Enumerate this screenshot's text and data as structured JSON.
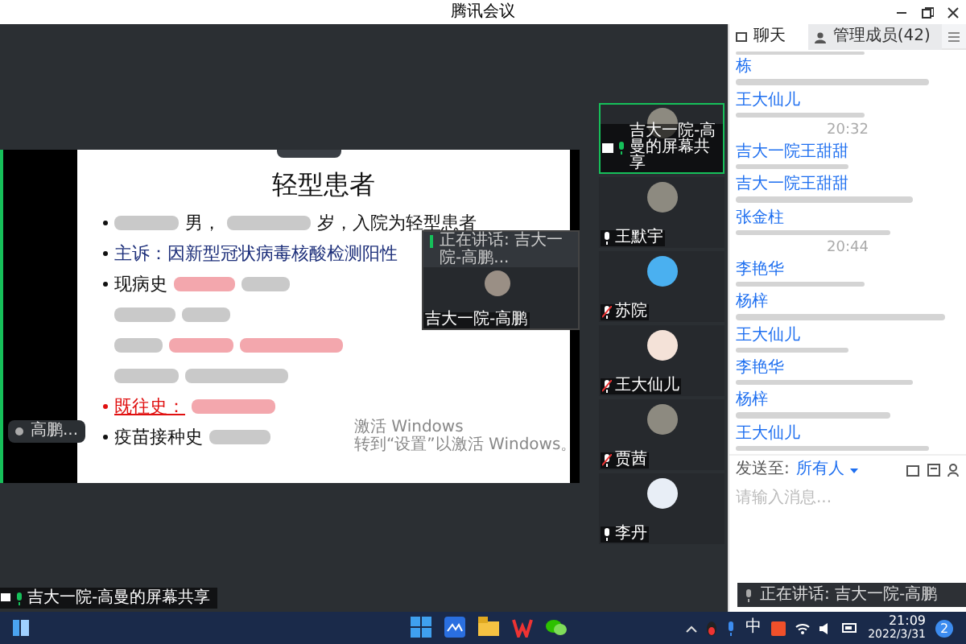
{
  "window": {
    "title": "腾讯会议"
  },
  "slide": {
    "title": "轻型患者",
    "bullets": [
      {
        "marker": true,
        "emphasis": false,
        "parts": [
          {
            "kind": "blur"
          },
          {
            "kind": "text",
            "text": "男，"
          },
          {
            "kind": "blur"
          },
          {
            "kind": "text",
            "text": "岁，入院为轻型患者"
          }
        ]
      },
      {
        "marker": true,
        "emphasis": false,
        "parts": [
          {
            "kind": "text",
            "text": "主诉：因新型冠状病毒核酸检测阳性"
          }
        ]
      },
      {
        "marker": true,
        "emphasis": false,
        "parts": [
          {
            "kind": "text",
            "text": "现病史"
          },
          {
            "kind": "redblur"
          },
          {
            "kind": "blur"
          }
        ]
      },
      {
        "marker": false,
        "parts": [
          {
            "kind": "blur"
          },
          {
            "kind": "blur"
          }
        ]
      },
      {
        "marker": false,
        "parts": [
          {
            "kind": "blur"
          },
          {
            "kind": "redblur"
          },
          {
            "kind": "redblur"
          }
        ]
      },
      {
        "marker": false,
        "parts": [
          {
            "kind": "blur"
          },
          {
            "kind": "blur"
          }
        ]
      },
      {
        "marker": true,
        "emphasis": true,
        "parts": [
          {
            "kind": "text",
            "text": "既往史："
          },
          {
            "kind": "redblur"
          }
        ]
      },
      {
        "marker": true,
        "emphasis": false,
        "parts": [
          {
            "kind": "text",
            "text": "疫苗接种史"
          },
          {
            "kind": "blur"
          }
        ]
      }
    ]
  },
  "activation_notice": [
    "激活 Windows",
    "转到“设置”以激活 Windows。"
  ],
  "side_label": "高鹏...",
  "presenter_label": "吉大一院-高曼的屏幕共享",
  "floating_video": {
    "speaking": "正在讲话: 吉大一院-高鹏...",
    "name": "吉大一院-高鹏"
  },
  "participants": [
    {
      "kind": "photo",
      "name": "吉大一院-高曼的屏幕共享",
      "speaking": true,
      "muted": false,
      "sharing": true
    },
    {
      "kind": "photo",
      "name": "王默宇",
      "speaking": false,
      "muted": false,
      "sharing": false
    },
    {
      "kind": "sky",
      "name": "苏院",
      "speaking": false,
      "muted": true,
      "sharing": false
    },
    {
      "kind": "cat",
      "name": "王大仙儿",
      "speaking": false,
      "muted": true,
      "sharing": false
    },
    {
      "kind": "photo",
      "name": "贾茜",
      "speaking": false,
      "muted": true,
      "sharing": false
    },
    {
      "kind": "doctor",
      "name": "李丹",
      "speaking": false,
      "muted": false,
      "sharing": false
    }
  ],
  "chat": {
    "tabs": [
      {
        "label": "聊天",
        "selected": true
      },
      {
        "label": "管理成员(42)",
        "selected": false
      }
    ],
    "items": [
      {
        "kind": "blur"
      },
      {
        "kind": "message",
        "sender": "栋"
      },
      {
        "kind": "message",
        "sender": "王大仙儿"
      },
      {
        "kind": "time",
        "text": "20:32"
      },
      {
        "kind": "message",
        "sender": "吉大一院王甜甜"
      },
      {
        "kind": "message",
        "sender": "吉大一院王甜甜"
      },
      {
        "kind": "message",
        "sender": "张金柱"
      },
      {
        "kind": "time",
        "text": "20:44"
      },
      {
        "kind": "message",
        "sender": "李艳华"
      },
      {
        "kind": "message",
        "sender": "杨梓"
      },
      {
        "kind": "message",
        "sender": "王大仙儿"
      },
      {
        "kind": "message",
        "sender": "李艳华"
      },
      {
        "kind": "message",
        "sender": "杨梓"
      },
      {
        "kind": "message",
        "sender": "王大仙儿"
      }
    ],
    "send_to_label": "发送至:",
    "recipient": "所有人",
    "input": {
      "placeholder": "请输入消息..."
    }
  },
  "toast": "正在讲话: 吉大一院-高鹏",
  "taskbar": {
    "ime": "中",
    "time": "21:09",
    "date": "2022/3/31",
    "badge": "2"
  }
}
